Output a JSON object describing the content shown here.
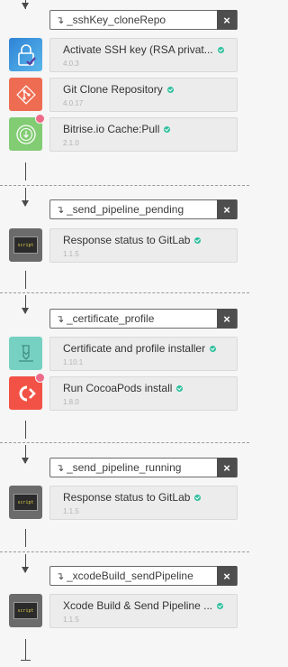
{
  "groups": [
    {
      "name": "_sshKey_cloneRepo",
      "steps": [
        {
          "title": "Activate SSH key (RSA privat...",
          "version": "4.0.3",
          "icon": "ssh-key-lock-icon",
          "color": "#3b8fd9"
        },
        {
          "title": "Git Clone Repository",
          "version": "4.0.17",
          "icon": "git-icon",
          "color": "#ee6d52"
        },
        {
          "title": "Bitrise.io Cache:Pull",
          "version": "2.1.0",
          "icon": "cache-pull-icon",
          "color": "#82cc74",
          "badge": true
        }
      ]
    },
    {
      "name": "_send_pipeline_pending",
      "steps": [
        {
          "title": "Response status to GitLab",
          "version": "1.1.5",
          "icon": "script-icon",
          "color": "#6b6b6b"
        }
      ]
    },
    {
      "name": "_certificate_profile",
      "steps": [
        {
          "title": "Certificate and profile installer",
          "version": "1.10.1",
          "icon": "certificate-icon",
          "color": "#77d1c2"
        },
        {
          "title": "Run CocoaPods install",
          "version": "1.8.0",
          "icon": "cocoapods-icon",
          "color": "#f25245",
          "badge": true
        }
      ]
    },
    {
      "name": "_send_pipeline_running",
      "steps": [
        {
          "title": "Response status to GitLab",
          "version": "1.1.5",
          "icon": "script-icon",
          "color": "#6b6b6b"
        }
      ]
    },
    {
      "name": "_xcodeBuild_sendPipeline",
      "steps": [
        {
          "title": "Xcode Build & Send Pipeline ...",
          "version": "1.1.5",
          "icon": "script-icon",
          "color": "#6b6b6b"
        }
      ]
    }
  ],
  "ui": {
    "ref_symbol": "↴",
    "remove_symbol": "×",
    "script_icon_text": "script"
  }
}
